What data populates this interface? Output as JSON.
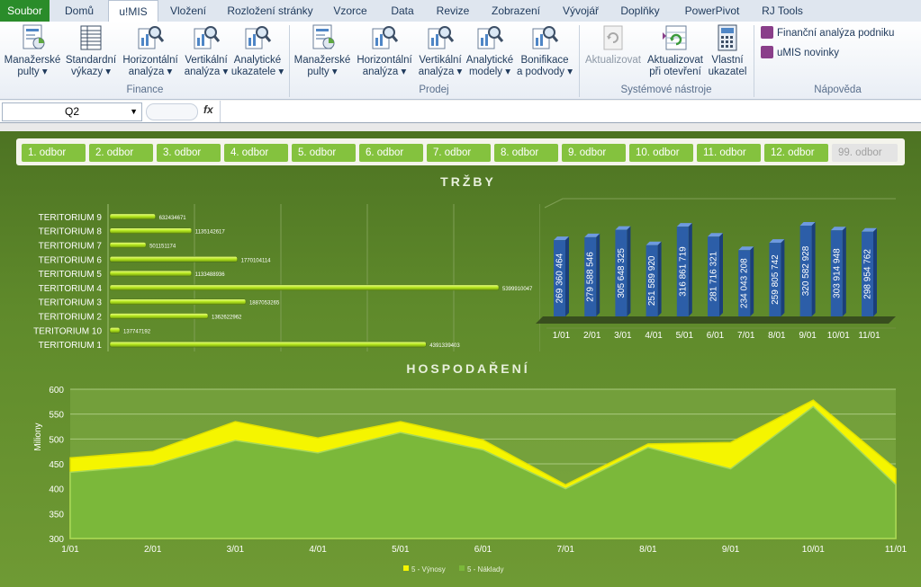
{
  "tabs": [
    "Soubor",
    "Domů",
    "u!MIS",
    "Vložení",
    "Rozložení stránky",
    "Vzorce",
    "Data",
    "Revize",
    "Zobrazení",
    "Vývojář",
    "Doplňky",
    "PowerPivot",
    "RJ Tools"
  ],
  "ribbon": {
    "finance": {
      "label": "Finance",
      "buttons": [
        {
          "line1": "Manažerské",
          "line2": "pulty ▾"
        },
        {
          "line1": "Standardní",
          "line2": "výkazy ▾"
        },
        {
          "line1": "Horizontální",
          "line2": "analýza ▾"
        },
        {
          "line1": "Vertikální",
          "line2": "analýza ▾"
        },
        {
          "line1": "Analytické",
          "line2": "ukazatele ▾"
        }
      ]
    },
    "prodej": {
      "label": "Prodej",
      "buttons": [
        {
          "line1": "Manažerské",
          "line2": "pulty ▾"
        },
        {
          "line1": "Horizontální",
          "line2": "analýza ▾"
        },
        {
          "line1": "Vertikální",
          "line2": "analýza ▾"
        },
        {
          "line1": "Analytické",
          "line2": "modely ▾"
        },
        {
          "line1": "Bonifikace",
          "line2": "a podvody ▾"
        }
      ]
    },
    "system": {
      "label": "Systémové nástroje",
      "buttons": [
        {
          "line1": "Aktualizovat",
          "line2": ""
        },
        {
          "line1": "Aktualizovat",
          "line2": "při otevření"
        },
        {
          "line1": "Vlastní",
          "line2": "ukazatel"
        }
      ]
    },
    "help": {
      "label": "Nápověda",
      "items": [
        "Finanční analýza podniku",
        "uMIS novinky"
      ]
    }
  },
  "formula_bar": {
    "name_box": "Q2",
    "fx": "fx",
    "value": ""
  },
  "departments": [
    "1. odbor",
    "2. odbor",
    "3. odbor",
    "4. odbor",
    "5. odbor",
    "6. odbor",
    "7. odbor",
    "8. odbor",
    "9. odbor",
    "10. odbor",
    "11. odbor",
    "12. odbor",
    "99. odbor"
  ],
  "colors": {
    "accent_green": "#84c23e",
    "bar_lime": "#b5e61d",
    "bar_blue": "#2c5ea8",
    "income_yellow": "#f5f500",
    "cost_green": "#7bb83a"
  },
  "chart_data": [
    {
      "type": "bar",
      "title": "TRŽBY",
      "orientation": "horizontal",
      "categories": [
        "TERITORIUM 9",
        "TERITORIUM 8",
        "TERITORIUM 7",
        "TERITORIUM 6",
        "TERITORIUM 5",
        "TERITORIUM 4",
        "TERITORIUM 3",
        "TERITORIUM 2",
        "TERITORIUM 10",
        "TERITORIUM 1"
      ],
      "values": [
        632434671,
        1135142617,
        501151174,
        1770104114,
        1133488936,
        5399910047,
        1887053265,
        1362622962,
        137747192,
        4391339403
      ],
      "labels": [
        "632434671",
        "1135142617",
        "501151174",
        "1770104114",
        "1133488936",
        "5399910047",
        "1887053265",
        "1362622962",
        "137747192",
        "4391339403"
      ],
      "xlim": [
        0,
        6000000000
      ],
      "grid": true
    },
    {
      "type": "bar",
      "orientation": "vertical",
      "categories": [
        "1/01",
        "2/01",
        "3/01",
        "4/01",
        "5/01",
        "6/01",
        "7/01",
        "8/01",
        "9/01",
        "10/01",
        "11/01"
      ],
      "values": [
        269360464,
        279588546,
        305648325,
        251589920,
        316861719,
        281716321,
        234043208,
        259805742,
        320582928,
        303914948,
        298954762
      ],
      "labels": [
        "269 360 464",
        "279 588 546",
        "305 648 325",
        "251 589 920",
        "316 861 719",
        "281 716 321",
        "234 043 208",
        "259 805 742",
        "320 582 928",
        "303 914 948",
        "298 954 762"
      ]
    },
    {
      "type": "area",
      "title": "HOSPODAŘENÍ",
      "ylabel": "Miliony",
      "categories": [
        "1/01",
        "2/01",
        "3/01",
        "4/01",
        "5/01",
        "6/01",
        "7/01",
        "8/01",
        "9/01",
        "10/01",
        "11/01"
      ],
      "ylim": [
        300,
        600
      ],
      "yticks": [
        "300",
        "350",
        "400",
        "450",
        "500",
        "550",
        "600"
      ],
      "series": [
        {
          "name": "5 - Výnosy",
          "values": [
            462,
            475,
            535,
            502,
            535,
            498,
            408,
            490,
            493,
            578,
            440
          ]
        },
        {
          "name": "5 - Náklady",
          "values": [
            433,
            447,
            497,
            472,
            513,
            478,
            400,
            483,
            440,
            565,
            408
          ]
        }
      ],
      "legend_position": "bottom",
      "grid": true
    }
  ]
}
